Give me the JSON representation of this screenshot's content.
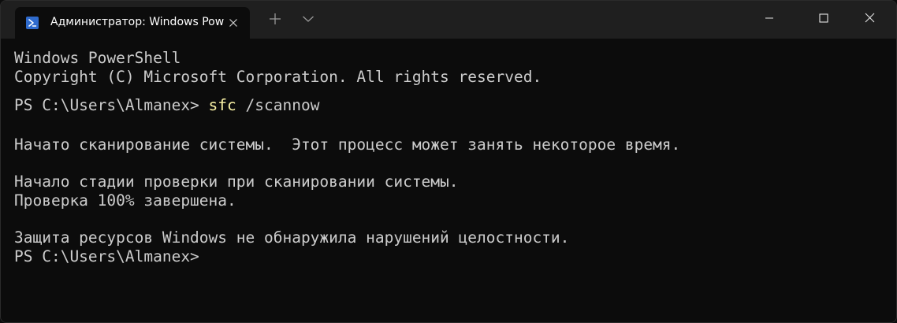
{
  "window": {
    "tab": {
      "title": "Администратор: Windows Pow"
    },
    "icons": {
      "tab_icon": "powershell-icon",
      "tab_close": "close-icon",
      "new_tab": "plus-icon",
      "dropdown": "chevron-down-icon",
      "minimize": "minimize-icon",
      "maximize": "maximize-icon",
      "close": "close-icon"
    }
  },
  "terminal": {
    "lines": [
      "Windows PowerShell",
      "Copyright (C) Microsoft Corporation. All rights reserved.",
      "",
      "Начато сканирование системы.  Этот процесс может занять некоторое время.",
      "Начало стадии проверки при сканировании системы.",
      "Проверка 100% завершена.",
      "Защита ресурсов Windows не обнаружила нарушений целостности.",
      "PS C:\\Users\\Almanex>"
    ],
    "command": {
      "prompt": "PS C:\\Users\\Almanex> ",
      "executable": "sfc",
      "args": " /scannow"
    }
  },
  "colors": {
    "background": "#0c0c0c",
    "titlebar": "#1f1f1f",
    "text": "#cccccc",
    "command": "#f9f1a5",
    "accent": "#2f6bcd"
  }
}
